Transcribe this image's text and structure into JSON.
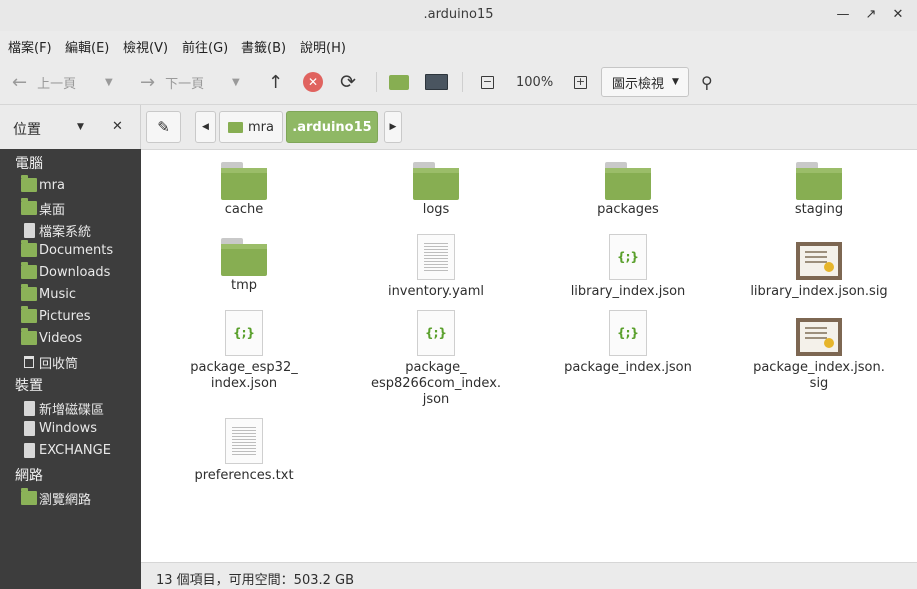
{
  "window": {
    "title": ".arduino15"
  },
  "menu": [
    "檔案(F)",
    "編輯(E)",
    "檢視(V)",
    "前往(G)",
    "書籤(B)",
    "說明(H)"
  ],
  "toolbar": {
    "back_label": "上一頁",
    "forward_label": "下一頁",
    "zoom": "100%",
    "view_mode": "圖示檢視"
  },
  "sidebar": {
    "header_label": "位置",
    "sections": [
      {
        "title": "電腦",
        "items": [
          "mra",
          "桌面",
          "檔案系統",
          "Documents",
          "Downloads",
          "Music",
          "Pictures",
          "Videos",
          "回收筒"
        ]
      },
      {
        "title": "裝置",
        "items": [
          "新增磁碟區",
          "Windows",
          "EXCHANGE"
        ]
      },
      {
        "title": "網路",
        "items": [
          "瀏覽網路"
        ]
      }
    ]
  },
  "pathbar": {
    "segments": [
      "mra",
      ".arduino15"
    ]
  },
  "files": [
    {
      "name": "cache",
      "type": "folder"
    },
    {
      "name": "logs",
      "type": "folder"
    },
    {
      "name": "packages",
      "type": "folder"
    },
    {
      "name": "staging",
      "type": "folder"
    },
    {
      "name": "tmp",
      "type": "folder"
    },
    {
      "name": "inventory.yaml",
      "type": "text"
    },
    {
      "name": "library_index.json",
      "type": "json"
    },
    {
      "name": "library_index.json.sig",
      "type": "cert"
    },
    {
      "name": "package_esp32_\nindex.json",
      "type": "json"
    },
    {
      "name": "package_\nesp8266com_index.\njson",
      "type": "json"
    },
    {
      "name": "package_index.json",
      "type": "json"
    },
    {
      "name": "package_index.json.\nsig",
      "type": "cert"
    },
    {
      "name": "preferences.txt",
      "type": "text"
    }
  ],
  "status": {
    "text": "13 個項目，可用空間：503.2 GB"
  },
  "colors": {
    "folder": "#87ae52",
    "sidebar_bg": "#3d3d3d",
    "active_path": "#8fb865",
    "stop": "#e0635f"
  }
}
